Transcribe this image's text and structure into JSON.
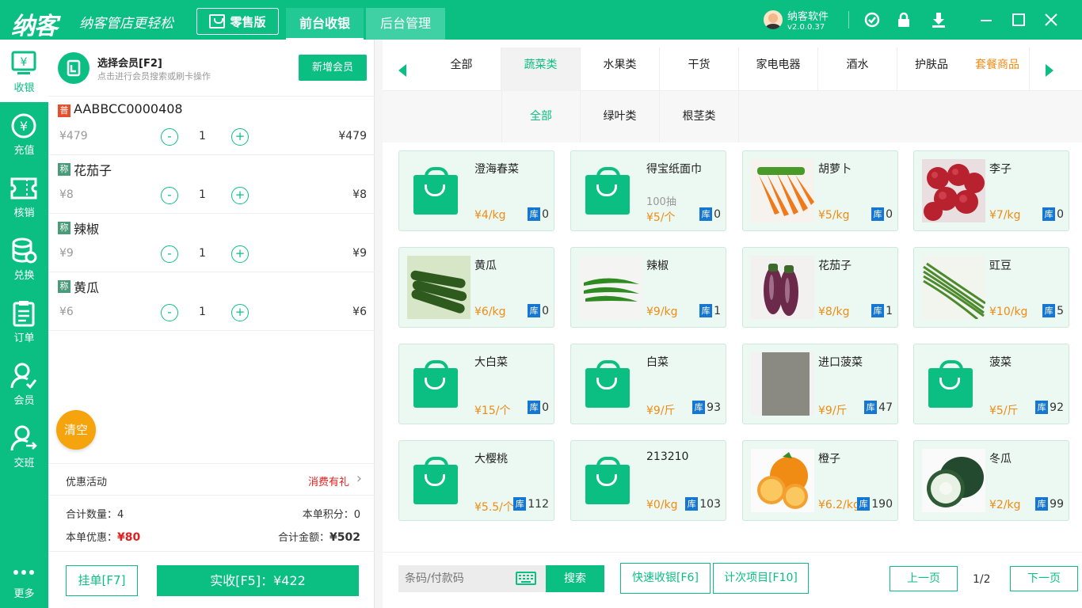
{
  "app": {
    "logo": "纳客",
    "slogan": "纳客管店更轻松",
    "retail_label": "零售版",
    "tabs": [
      "前台收银",
      "后台管理"
    ],
    "user": {
      "name": "纳客软件",
      "version": "v2.0.0.37"
    }
  },
  "sidebar": [
    {
      "label": "收银",
      "icon": "cashier-icon"
    },
    {
      "label": "充值",
      "icon": "recharge-icon"
    },
    {
      "label": "核销",
      "icon": "ticket-icon"
    },
    {
      "label": "兑换",
      "icon": "coins-icon"
    },
    {
      "label": "订单",
      "icon": "clipboard-icon"
    },
    {
      "label": "会员",
      "icon": "member-icon"
    },
    {
      "label": "交班",
      "icon": "shift-icon"
    },
    {
      "label": "更多",
      "icon": "more-icon"
    }
  ],
  "member": {
    "title": "选择会员[F2]",
    "subtitle": "点击进行会员搜索或刷卡操作",
    "new_button": "新增会员"
  },
  "cart": [
    {
      "tag": "普",
      "tag_type": "pu",
      "name": "AABBCC0000408",
      "price": "¥479",
      "qty": "1",
      "total": "¥479"
    },
    {
      "tag": "称",
      "tag_type": "cheng",
      "name": "花茄子",
      "price": "¥8",
      "qty": "1",
      "total": "¥8"
    },
    {
      "tag": "称",
      "tag_type": "cheng",
      "name": "辣椒",
      "price": "¥9",
      "qty": "1",
      "total": "¥9"
    },
    {
      "tag": "称",
      "tag_type": "cheng",
      "name": "黄瓜",
      "price": "¥6",
      "qty": "1",
      "total": "¥6"
    }
  ],
  "clear_label": "清空",
  "promo": {
    "label": "优惠活动",
    "value": "消费有礼"
  },
  "summary": {
    "count_label": "合计数量：",
    "count": "4",
    "points_label": "本单积分：",
    "points": "0",
    "discount_label": "本单优惠：",
    "discount": "¥80",
    "total_label": "合计金额：",
    "total": "¥502"
  },
  "actions": {
    "hang": "挂单[F7]",
    "pay": "实收[F5]：¥422"
  },
  "categories": [
    "全部",
    "蔬菜类",
    "水果类",
    "干货",
    "家电电器",
    "酒水",
    "护肤品"
  ],
  "category_special": "套餐商品",
  "subcategories": [
    "全部",
    "绿叶类",
    "根茎类"
  ],
  "products": [
    {
      "name": "澄海春菜",
      "desc": "",
      "price": "¥4/kg",
      "stock": "0",
      "img": "bag"
    },
    {
      "name": "得宝纸面巾",
      "desc": "100抽",
      "price": "¥5/个",
      "stock": "0",
      "img": "bag"
    },
    {
      "name": "胡萝卜",
      "desc": "",
      "price": "¥5/kg",
      "stock": "0",
      "img": "carrot"
    },
    {
      "name": "李子",
      "desc": "",
      "price": "¥7/kg",
      "stock": "0",
      "img": "plum"
    },
    {
      "name": "黄瓜",
      "desc": "",
      "price": "¥6/kg",
      "stock": "0",
      "img": "cucumber"
    },
    {
      "name": "辣椒",
      "desc": "",
      "price": "¥9/kg",
      "stock": "1",
      "img": "pepper"
    },
    {
      "name": "花茄子",
      "desc": "",
      "price": "¥8/kg",
      "stock": "1",
      "img": "eggplant"
    },
    {
      "name": "豇豆",
      "desc": "",
      "price": "¥10/kg",
      "stock": "5",
      "img": "bean"
    },
    {
      "name": "大白菜",
      "desc": "",
      "price": "¥15/个",
      "stock": "0",
      "img": "bag"
    },
    {
      "name": "白菜",
      "desc": "",
      "price": "¥9/斤",
      "stock": "93",
      "img": "bag"
    },
    {
      "name": "进口菠菜",
      "desc": "",
      "price": "¥9/斤",
      "stock": "47",
      "img": "gray"
    },
    {
      "name": "菠菜",
      "desc": "",
      "price": "¥5/斤",
      "stock": "92",
      "img": "bag"
    },
    {
      "name": "大樱桃",
      "desc": "",
      "price": "¥5.5/个",
      "stock": "112",
      "img": "bag"
    },
    {
      "name": "213210",
      "desc": "",
      "price": "¥0/kg",
      "stock": "103",
      "img": "bag"
    },
    {
      "name": "橙子",
      "desc": "",
      "price": "¥6.2/kg",
      "stock": "190",
      "img": "orange"
    },
    {
      "name": "冬瓜",
      "desc": "",
      "price": "¥2/kg",
      "stock": "99",
      "img": "melon"
    }
  ],
  "stock_tag": "库",
  "search": {
    "placeholder": "条码/付款码",
    "button": "搜索"
  },
  "quick_pay": "快速收银[F6]",
  "count_item": "计次项目[F10]",
  "pager": {
    "prev": "上一页",
    "page": "1/2",
    "next": "下一页"
  },
  "colors": {
    "primary": "#0bbf83",
    "price": "#f08b14",
    "clear": "#f5a40e",
    "stock_tag": "#1677d2"
  }
}
